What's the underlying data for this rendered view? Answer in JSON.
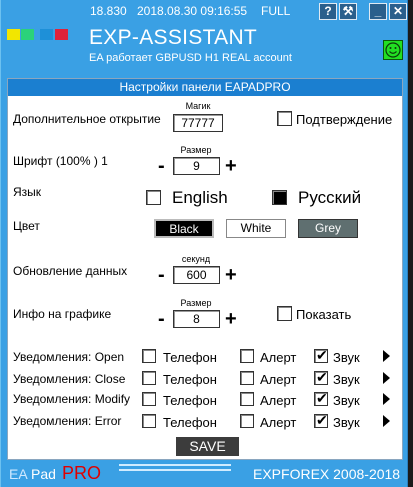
{
  "titlebar": {
    "balance": "18.830",
    "datetime": "2018.08.30 09:16:55",
    "mode": "FULL",
    "help_label": "?",
    "tools_label": "⚒",
    "minimize_label": "_",
    "close_label": "✕"
  },
  "header": {
    "title": "EXP-ASSISTANT",
    "subtitle": "EA работает GBPUSD  H1 REAL account",
    "logo_colors": [
      "#f2e600",
      "#2bd27a",
      "#1e90d8",
      "#e0223a"
    ]
  },
  "panel": {
    "title": "Настройки панели EAPADPRO",
    "additional_open": {
      "label": "Дополнительное открытие",
      "magic_caption": "Магик",
      "magic_value": "77777",
      "confirm_label": "Подтверждение",
      "confirm_checked": false
    },
    "font": {
      "label": "Шрифт  (100% ) 1",
      "size_caption": "Размер",
      "size_value": "9",
      "minus": "-",
      "plus": "+"
    },
    "language": {
      "label": "Язык",
      "english_label": "English",
      "english_checked": false,
      "russian_label": "Русский",
      "russian_checked": true
    },
    "color": {
      "label": "Цвет",
      "black_label": "Black",
      "white_label": "White",
      "grey_label": "Grey"
    },
    "update": {
      "label": "Обновление данных",
      "caption": "секунд",
      "value": "600",
      "minus": "-",
      "plus": "+"
    },
    "chart_info": {
      "label": "Инфо на графике",
      "caption": "Размер",
      "value": "8",
      "minus": "-",
      "plus": "+",
      "show_label": "Показать",
      "show_checked": false
    },
    "notifications": [
      {
        "label": "Уведомления: Open",
        "phone": "Телефон",
        "alert": "Алерт",
        "sound": "Звук",
        "phone_checked": false,
        "alert_checked": false,
        "sound_checked": true
      },
      {
        "label": "Уведомления: Close",
        "phone": "Телефон",
        "alert": "Алерт",
        "sound": "Звук",
        "phone_checked": false,
        "alert_checked": false,
        "sound_checked": true
      },
      {
        "label": "Уведомления: Modify",
        "phone": "Телефон",
        "alert": "Алерт",
        "sound": "Звук",
        "phone_checked": false,
        "alert_checked": false,
        "sound_checked": true
      },
      {
        "label": "Уведомления: Error",
        "phone": "Телефон",
        "alert": "Алерт",
        "sound": "Звук",
        "phone_checked": false,
        "alert_checked": false,
        "sound_checked": true
      }
    ],
    "save_label": "SAVE"
  },
  "footer": {
    "ea": "EA",
    "pad": "Pad",
    "pro": "PRO",
    "copyright": "EXPFOREX 2008-2018"
  },
  "colors": {
    "frame": "#3aa0e4",
    "header_bar": "#1b7fd0",
    "black_button": "#000000",
    "grey_button": "#5f6f70",
    "pro_red": "#e00000",
    "status_green": "#22e022"
  }
}
